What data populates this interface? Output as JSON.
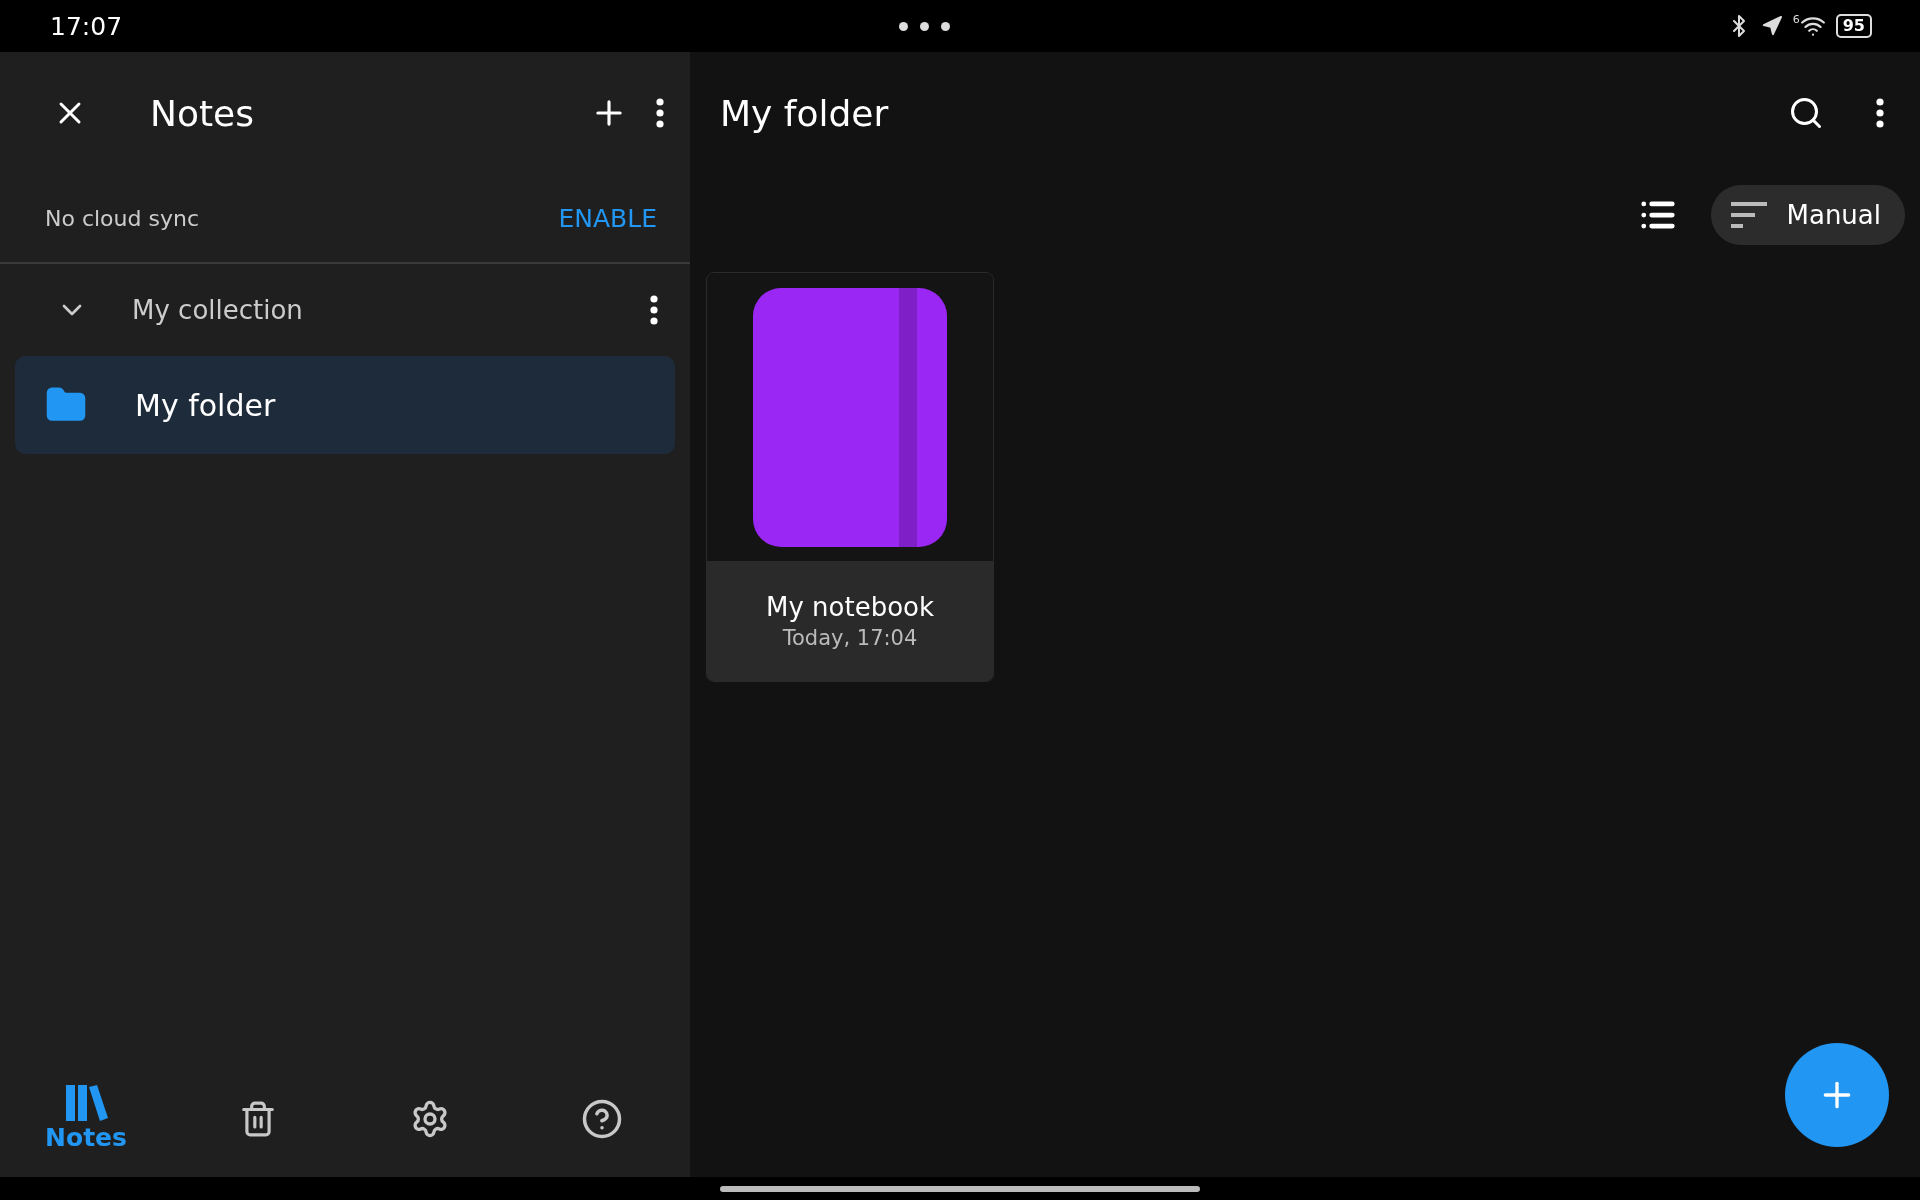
{
  "status_bar": {
    "time": "17:07",
    "wifi_label": "6",
    "battery": "95"
  },
  "sidebar": {
    "title": "Notes",
    "sync": {
      "text": "No cloud sync",
      "action": "ENABLE"
    },
    "collection": {
      "name": "My collection",
      "expanded": true,
      "items": [
        {
          "name": "My folder",
          "selected": true
        }
      ]
    }
  },
  "bottom_nav": [
    {
      "kind": "library",
      "label": "Notes",
      "selected": true
    },
    {
      "kind": "trash",
      "selected": false
    },
    {
      "kind": "settings",
      "selected": false
    },
    {
      "kind": "help",
      "selected": false
    }
  ],
  "main": {
    "title": "My folder",
    "sort": "Manual",
    "notebooks": [
      {
        "name": "My notebook",
        "date": "Today, 17:04",
        "color": "#9b27f5"
      }
    ]
  }
}
